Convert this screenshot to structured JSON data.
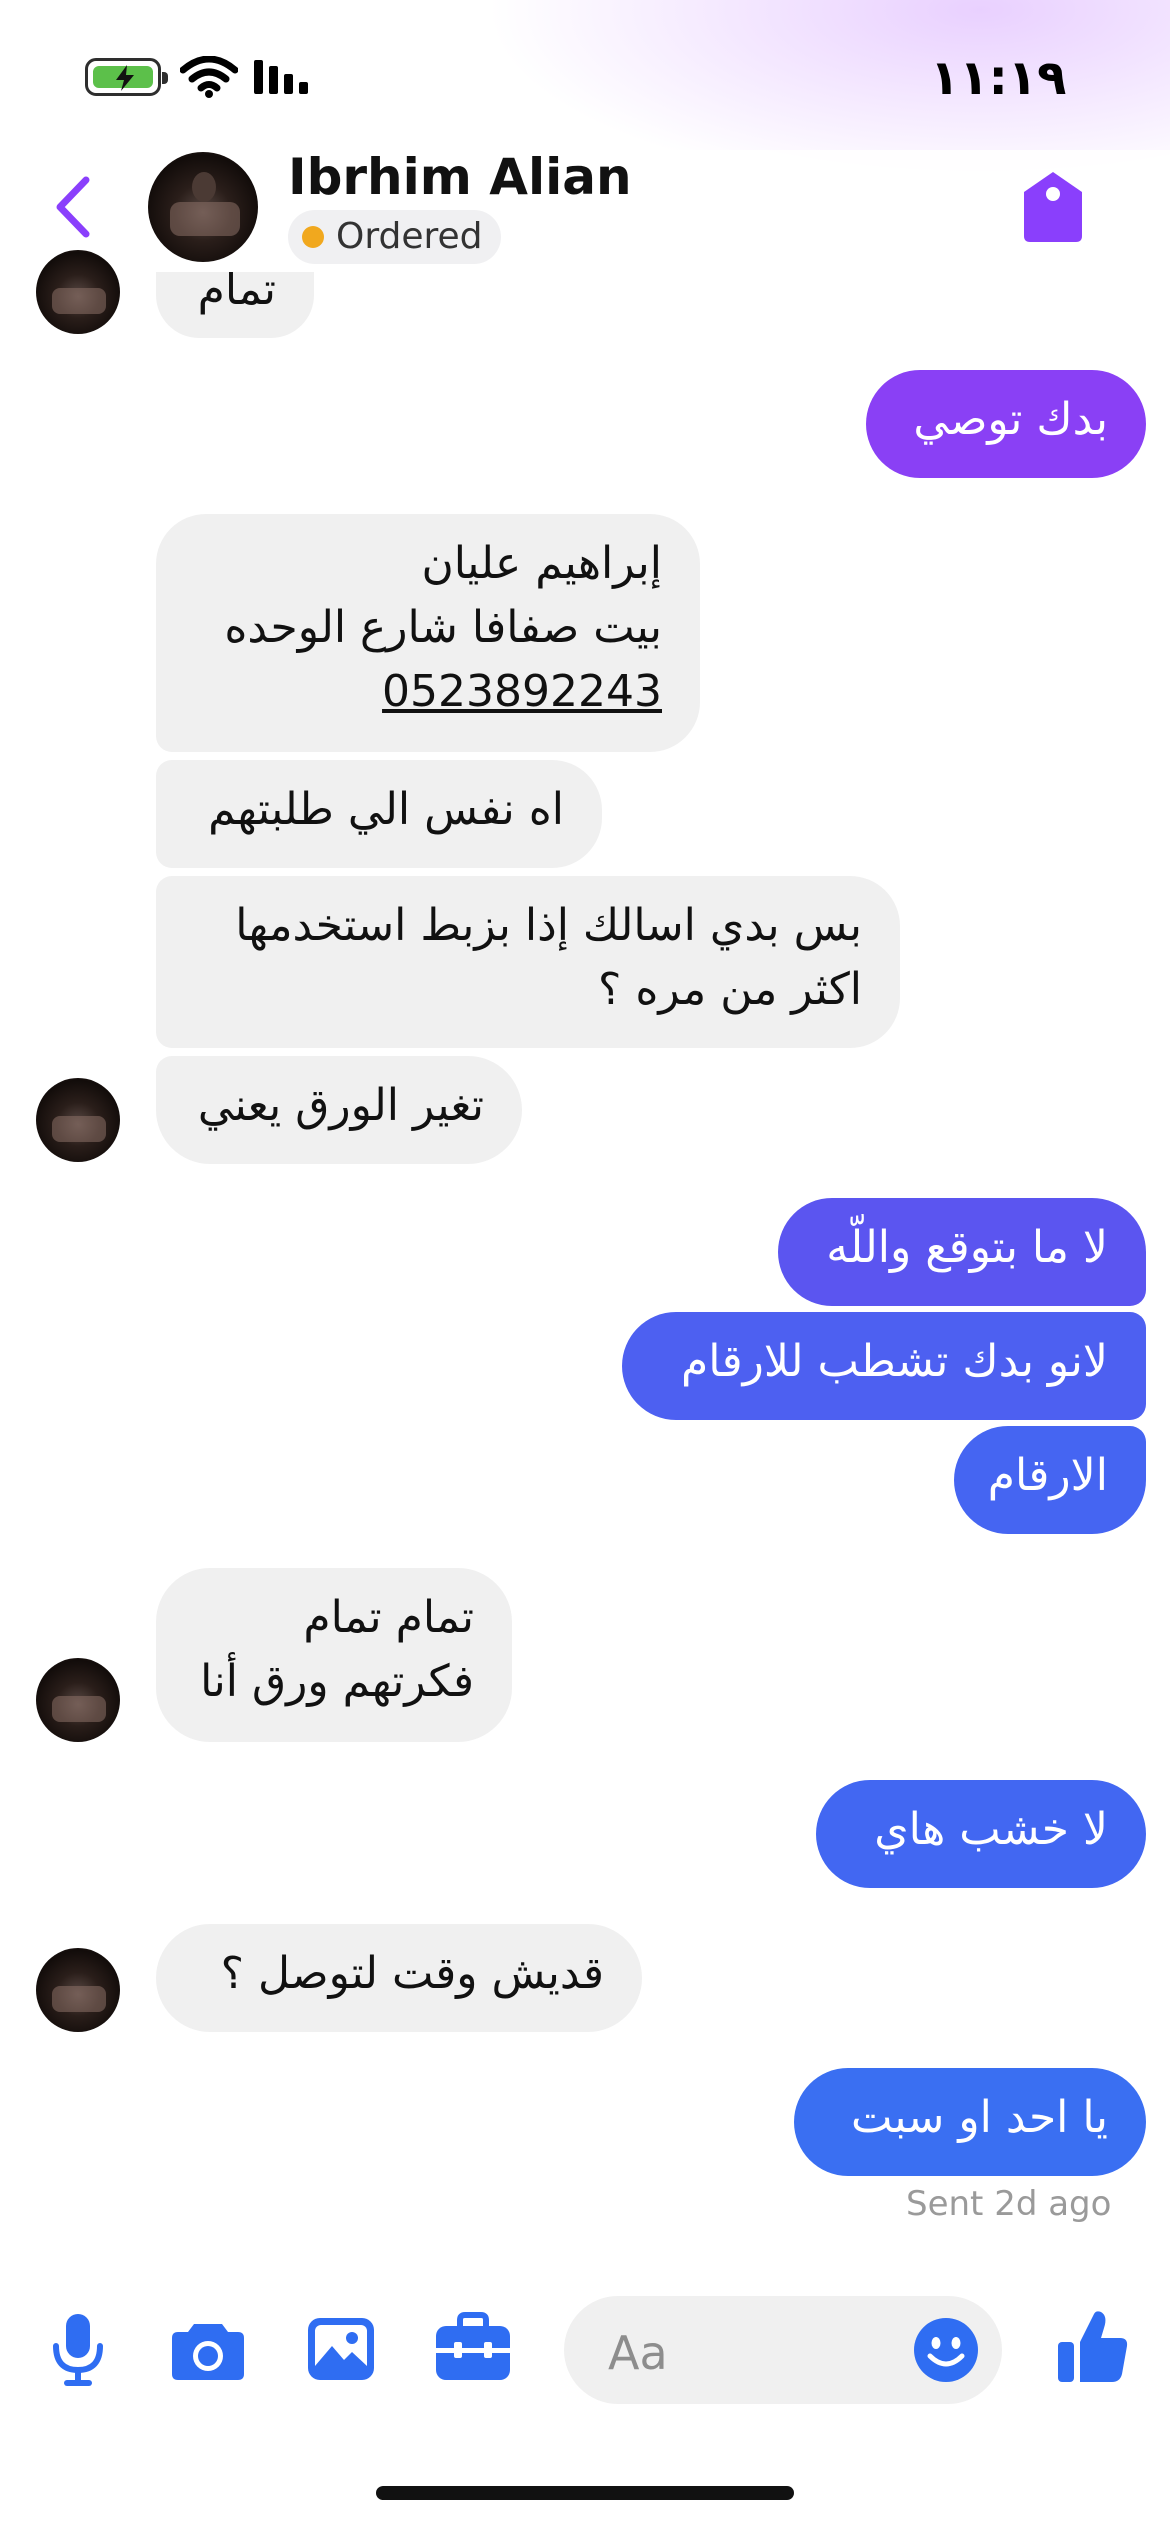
{
  "status_bar": {
    "time": "١١:١٩"
  },
  "header": {
    "name": "Ibrhim Alian",
    "status": "Ordered"
  },
  "messages": [
    {
      "from": "them",
      "text": "تمام"
    },
    {
      "from": "me",
      "text": "بدك توصي"
    },
    {
      "from": "them",
      "lines": [
        "إبراهيم عليان",
        "بيت صفافا شارع الوحده"
      ],
      "phone": "0523892243"
    },
    {
      "from": "them",
      "text": "اه نفس الي طلبتهم"
    },
    {
      "from": "them",
      "lines": [
        "بس بدي اسالك إذا بزبط استخدمها",
        "اكثر من مره ؟"
      ]
    },
    {
      "from": "them",
      "text": "تغير الورق يعني"
    },
    {
      "from": "me",
      "text": "لا ما بتوقع واللّه"
    },
    {
      "from": "me",
      "text": "لانو بدك تشطب للارقام"
    },
    {
      "from": "me",
      "text": "الارقام"
    },
    {
      "from": "them",
      "lines": [
        "تمام تمام",
        "فكرتهم ورق أنا"
      ]
    },
    {
      "from": "me",
      "text": "لا خشب هاي"
    },
    {
      "from": "them",
      "text": "قديش وقت لتوصل ؟"
    },
    {
      "from": "me",
      "text": "يا احد او سبت"
    }
  ],
  "sent_note": "Sent 2d ago",
  "composer": {
    "placeholder": "Aa"
  },
  "colors": {
    "accent": "#8a3ffc",
    "out_top": "#8a40f5",
    "out_mid": "#5b55f0",
    "out_bottom": "#3a6ff2",
    "incoming_bg": "#f0f0f0",
    "toolbar_icon": "#2f6df2"
  },
  "icons": [
    "battery-icon",
    "wifi-icon",
    "signal-icon",
    "back-chevron-icon",
    "tag-icon",
    "microphone-icon",
    "camera-icon",
    "gallery-icon",
    "toolbox-icon",
    "smiley-icon",
    "thumbs-up-icon"
  ]
}
